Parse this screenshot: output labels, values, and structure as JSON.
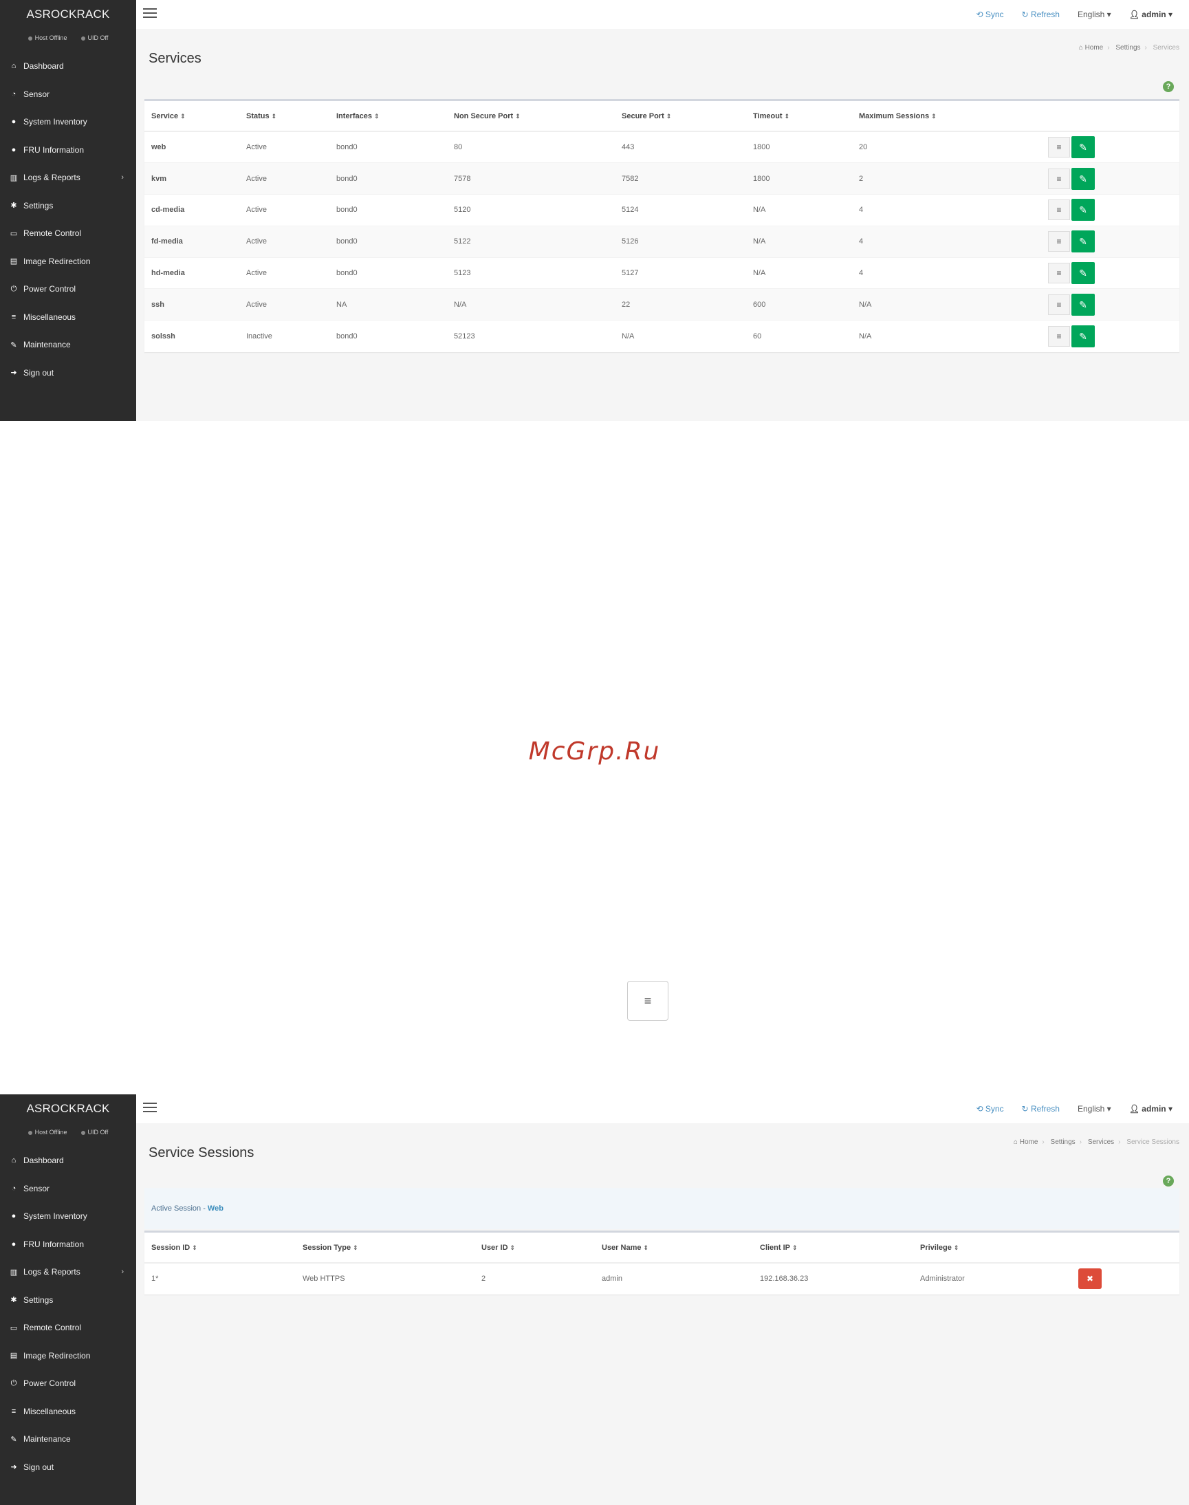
{
  "app": {
    "brand": "ASROCKRACK",
    "status": {
      "host": "Host Offline",
      "uid": "UID Off"
    }
  },
  "topbar": {
    "sync": "Sync",
    "refresh": "Refresh",
    "language": "English",
    "user": "admin"
  },
  "sidebar": {
    "items": [
      {
        "label": "Dashboard",
        "icon": "home-icon"
      },
      {
        "label": "Sensor",
        "icon": "dashboard-gauge-icon"
      },
      {
        "label": "System Inventory",
        "icon": "info-circle-icon"
      },
      {
        "label": "FRU Information",
        "icon": "info-circle-icon"
      },
      {
        "label": "Logs & Reports",
        "icon": "bar-chart-icon"
      },
      {
        "label": "Settings",
        "icon": "gear-icon"
      },
      {
        "label": "Remote Control",
        "icon": "monitor-icon"
      },
      {
        "label": "Image Redirection",
        "icon": "disk-icon"
      },
      {
        "label": "Power Control",
        "icon": "power-icon"
      },
      {
        "label": "Miscellaneous",
        "icon": "list-icon"
      },
      {
        "label": "Maintenance",
        "icon": "wrench-icon"
      },
      {
        "label": "Sign out",
        "icon": "sign-out-icon"
      }
    ]
  },
  "services_page": {
    "title": "Services",
    "breadcrumb": [
      "Home",
      "Settings",
      "Services"
    ],
    "columns": [
      "Service",
      "Status",
      "Interfaces",
      "Non Secure Port",
      "Secure Port",
      "Timeout",
      "Maximum Sessions"
    ],
    "rows": [
      [
        "web",
        "Active",
        "bond0",
        "80",
        "443",
        "1800",
        "20"
      ],
      [
        "kvm",
        "Active",
        "bond0",
        "7578",
        "7582",
        "1800",
        "2"
      ],
      [
        "cd-media",
        "Active",
        "bond0",
        "5120",
        "5124",
        "N/A",
        "4"
      ],
      [
        "fd-media",
        "Active",
        "bond0",
        "5122",
        "5126",
        "N/A",
        "4"
      ],
      [
        "hd-media",
        "Active",
        "bond0",
        "5123",
        "5127",
        "N/A",
        "4"
      ],
      [
        "ssh",
        "Active",
        "NA",
        "N/A",
        "22",
        "600",
        "N/A"
      ],
      [
        "solssh",
        "Inactive",
        "bond0",
        "52123",
        "N/A",
        "60",
        "N/A"
      ]
    ]
  },
  "watermark": "McGrp.Ru",
  "sessions_page": {
    "title": "Service Sessions",
    "breadcrumb": [
      "Home",
      "Settings",
      "Services",
      "Service Sessions"
    ],
    "info_prefix": "Active Session - ",
    "info_service": "Web",
    "columns": [
      "Session ID",
      "Session Type",
      "User ID",
      "User Name",
      "Client IP",
      "Privilege"
    ],
    "rows": [
      [
        "1*",
        "Web HTTPS",
        "2",
        "admin",
        "192.168.36.23",
        "Administrator"
      ]
    ]
  }
}
